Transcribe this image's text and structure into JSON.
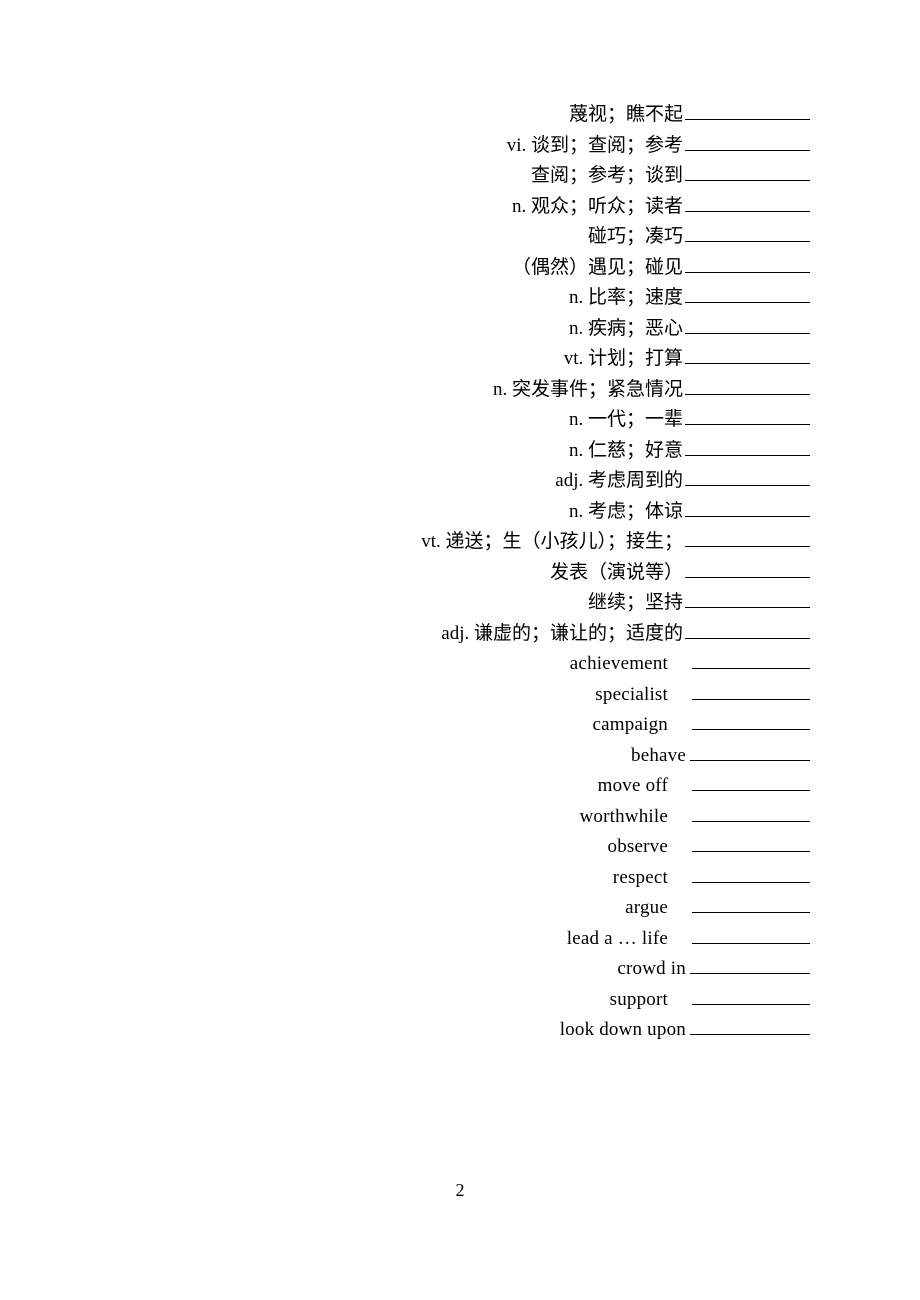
{
  "page_number": "2",
  "top": [
    {
      "label": "蔑视；瞧不起"
    },
    {
      "label": "vi. 谈到；查阅；参考"
    },
    {
      "label": "查阅；参考；谈到"
    },
    {
      "label": "n. 观众；听众；读者"
    },
    {
      "label": "碰巧；凑巧"
    },
    {
      "label": "（偶然）遇见；碰见"
    },
    {
      "label": "n. 比率；速度"
    },
    {
      "label": "n. 疾病；恶心"
    },
    {
      "label": "vt. 计划；打算"
    },
    {
      "label": "n. 突发事件；紧急情况"
    },
    {
      "label": "n. 一代；一辈"
    },
    {
      "label": "n. 仁慈；好意"
    },
    {
      "label": "adj. 考虑周到的"
    },
    {
      "label": "n. 考虑；体谅"
    },
    {
      "label": "vt. 递送；生（小孩儿）；接生；"
    },
    {
      "label": "发表（演说等）"
    },
    {
      "label": "继续；坚持"
    },
    {
      "label": "adj. 谦虚的；谦让的；适度的"
    }
  ],
  "bottom": [
    {
      "label": "achievement"
    },
    {
      "label": "specialist"
    },
    {
      "label": "campaign"
    },
    {
      "label": "behave"
    },
    {
      "label": "move off"
    },
    {
      "label": "worthwhile"
    },
    {
      "label": "observe"
    },
    {
      "label": "respect"
    },
    {
      "label": "argue"
    },
    {
      "label": "lead a … life"
    },
    {
      "label": "crowd in"
    },
    {
      "label": "support"
    },
    {
      "label": "look down upon"
    }
  ]
}
